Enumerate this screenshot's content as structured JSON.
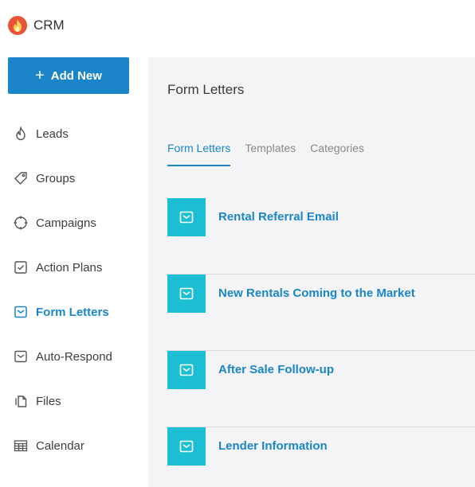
{
  "app": {
    "name": "CRM",
    "logo_icon": "flame-icon",
    "logo_color": "#e8533b"
  },
  "sidebar": {
    "add_new_label": "Add New",
    "items": [
      {
        "label": "Leads",
        "icon": "flame-outline-icon"
      },
      {
        "label": "Groups",
        "icon": "tag-icon"
      },
      {
        "label": "Campaigns",
        "icon": "target-icon"
      },
      {
        "label": "Action Plans",
        "icon": "checkbox-icon"
      },
      {
        "label": "Form Letters",
        "icon": "envelope-icon",
        "active": true
      },
      {
        "label": "Auto-Respond",
        "icon": "envelope-icon"
      },
      {
        "label": "Files",
        "icon": "files-icon"
      },
      {
        "label": "Calendar",
        "icon": "calendar-icon"
      }
    ]
  },
  "main": {
    "title": "Form Letters",
    "tabs": [
      {
        "label": "Form Letters",
        "active": true
      },
      {
        "label": "Templates"
      },
      {
        "label": "Categories"
      }
    ],
    "letters": [
      {
        "title": "Rental Referral Email"
      },
      {
        "title": "New Rentals Coming to the Market"
      },
      {
        "title": "After Sale Follow-up"
      },
      {
        "title": "Lender Information"
      }
    ]
  },
  "colors": {
    "accent": "#1a86c9",
    "icon_tile": "#1cbed3",
    "main_bg": "#f4f4f6"
  }
}
